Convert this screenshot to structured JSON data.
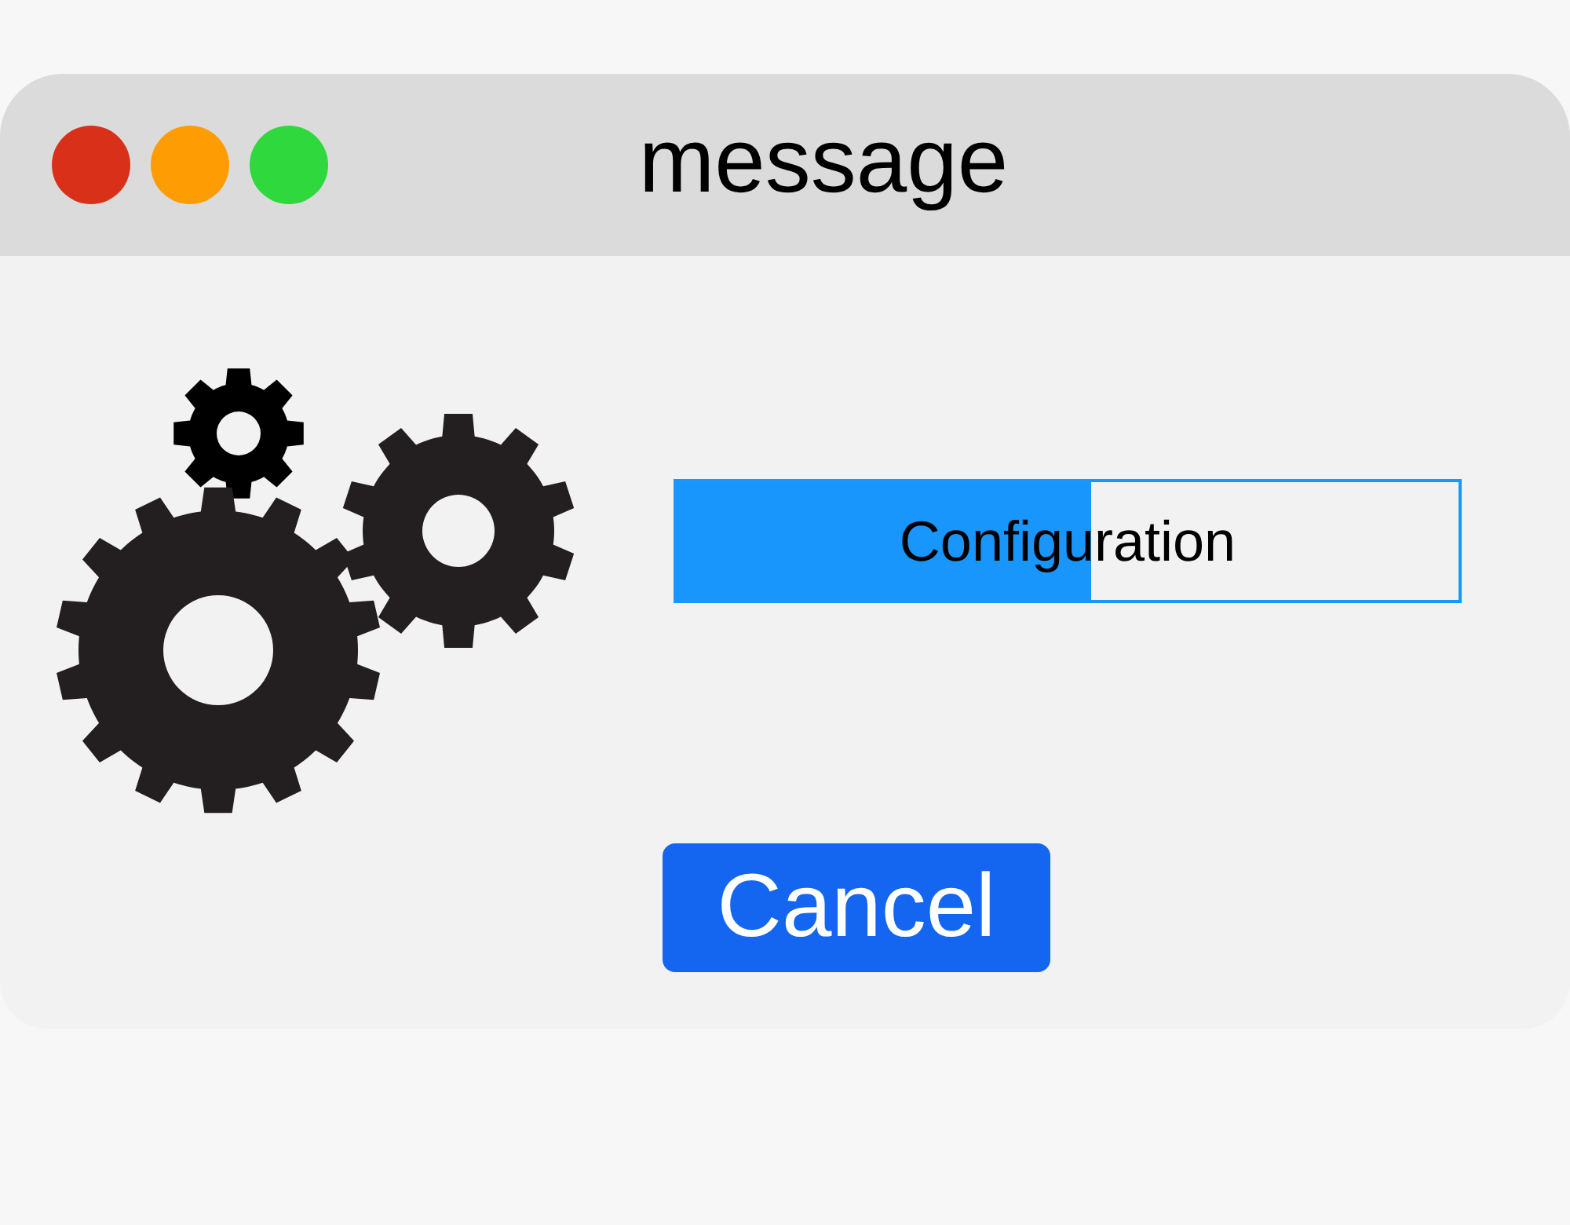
{
  "window": {
    "title": "message",
    "controls": [
      {
        "color": "#d9301a"
      },
      {
        "color": "#fe9c03"
      },
      {
        "color": "#2fd93d"
      }
    ]
  },
  "progress": {
    "label": "Configuration",
    "level": 0.53
  },
  "buttons": [
    {
      "label": "Cancel"
    }
  ]
}
